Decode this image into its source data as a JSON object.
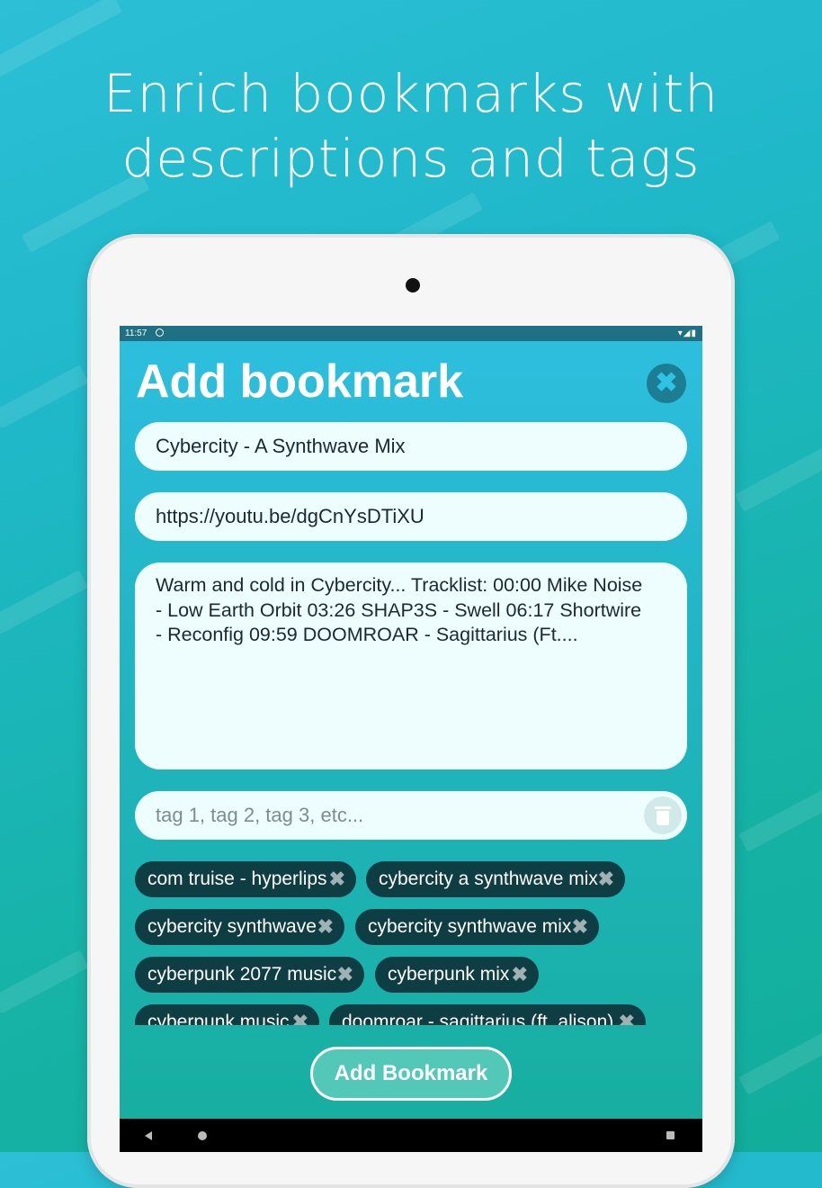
{
  "headline": {
    "line1": "Enrich bookmarks with",
    "line2": "descriptions and tags"
  },
  "status_bar": {
    "time": "11:57",
    "icons": "▾◢▮"
  },
  "form": {
    "title": "Add bookmark",
    "close_icon": "✖",
    "name_value": "Cybercity - A Synthwave Mix",
    "url_value": "https://youtu.be/dgCnYsDTiXU",
    "description_value": "Warm and cold in Cybercity... Tracklist: 00:00 Mike Noise - Low Earth Orbit 03:26 SHAP3S - Swell 06:17 Shortwire - Reconfig 09:59 DOOMROAR - Sagittarius (Ft....",
    "tags_placeholder": "tag 1, tag 2, tag 3, etc...",
    "tags": [
      {
        "label": "com truise - hyperlips"
      },
      {
        "label": "cybercity a synthwave mix"
      },
      {
        "label": "cybercity synthwave"
      },
      {
        "label": "cybercity synthwave mix"
      },
      {
        "label": "cyberpunk 2077 music"
      },
      {
        "label": "cyberpunk mix"
      },
      {
        "label": "cyberpunk music"
      },
      {
        "label": "doomroar - sagittarius (ft. alison)"
      }
    ],
    "tag_remove_icon": "✖",
    "submit_label": "Add Bookmark"
  },
  "icons": {
    "close": "close-icon",
    "trash": "trash-icon",
    "chip_remove": "close-icon"
  },
  "colors": {
    "chip_bg": "#0f3d44",
    "field_bg": "#eefdfd",
    "accent": "#53c7b8"
  }
}
